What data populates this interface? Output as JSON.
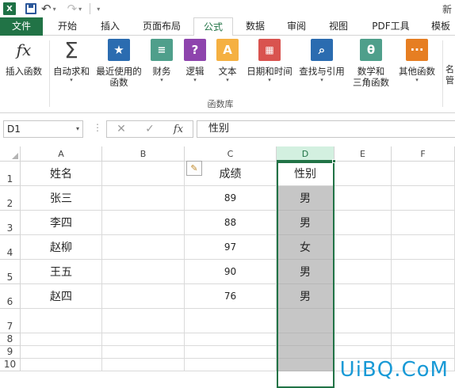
{
  "titlebar": {
    "app_glyph": "X",
    "right_text": "新"
  },
  "tabs": [
    "文件",
    "开始",
    "插入",
    "页面布局",
    "公式",
    "数据",
    "审阅",
    "视图",
    "PDF工具",
    "模板"
  ],
  "active_tab_index": 4,
  "ribbon": {
    "buttons": [
      {
        "label": "插入函数",
        "icon": "fx-icon"
      },
      {
        "label": "自动求和",
        "icon": "sigma-icon"
      },
      {
        "label": "最近使用的\n函数",
        "icon": "star-icon"
      },
      {
        "label": "财务",
        "icon": "coins-icon"
      },
      {
        "label": "逻辑",
        "icon": "question-icon"
      },
      {
        "label": "文本",
        "icon": "text-a-icon"
      },
      {
        "label": "日期和时间",
        "icon": "calendar-icon"
      },
      {
        "label": "查找与引用",
        "icon": "magnifier-icon"
      },
      {
        "label": "数学和\n三角函数",
        "icon": "theta-icon"
      },
      {
        "label": "其他函数",
        "icon": "more-icon"
      }
    ],
    "group_label": "函数库",
    "right_cut": "名\n管"
  },
  "formula_bar": {
    "name_box": "D1",
    "fx_label": "fx",
    "content": "性别"
  },
  "columns": [
    "A",
    "B",
    "C",
    "D",
    "E",
    "F"
  ],
  "rows": [
    "1",
    "2",
    "3",
    "4",
    "5",
    "6",
    "7",
    "8",
    "9",
    "10"
  ],
  "table": {
    "header": {
      "name": "姓名",
      "score": "成绩",
      "gender": "性别"
    },
    "records": [
      {
        "name": "张三",
        "score": "89",
        "gender": "男"
      },
      {
        "name": "李四",
        "score": "88",
        "gender": "男"
      },
      {
        "name": "赵柳",
        "score": "97",
        "gender": "女"
      },
      {
        "name": "王五",
        "score": "90",
        "gender": "男"
      },
      {
        "name": "赵四",
        "score": "76",
        "gender": "男"
      }
    ]
  },
  "watermark": "UiBQ.CoM",
  "colors": {
    "accent": "#217346",
    "selection_fill": "#c6c6c6",
    "watermark": "#1a9ad6"
  }
}
